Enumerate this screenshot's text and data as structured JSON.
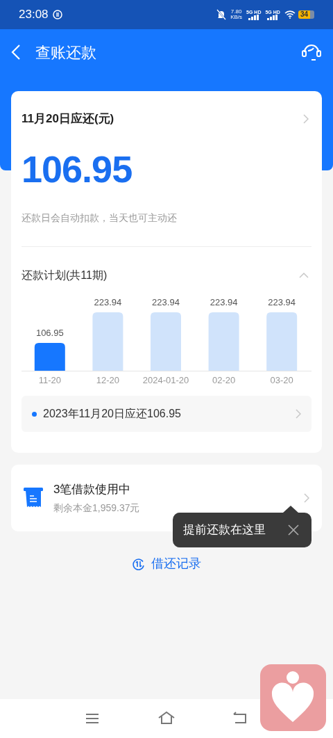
{
  "status_bar": {
    "time": "23:08",
    "speed": "7.80",
    "speed_unit": "KB/s",
    "networks": [
      "5G HD",
      "5G HD"
    ],
    "battery": "34"
  },
  "header": {
    "title": "查账还款"
  },
  "due_card": {
    "title": "11月20日应还(元)",
    "amount": "106.95",
    "note": "还款日会自动扣款，当天也可主动还"
  },
  "plan": {
    "title": "还款计划(共11期)",
    "expanded": true,
    "chart_data": {
      "type": "bar",
      "categories": [
        "11-20",
        "12-20",
        "2024-01-20",
        "02-20",
        "03-20"
      ],
      "values": [
        106.95,
        223.94,
        223.94,
        223.94,
        223.94
      ],
      "data_labels": true
    },
    "bars": [
      {
        "selected": true
      },
      {
        "selected": false
      },
      {
        "selected": false
      },
      {
        "selected": false
      },
      {
        "selected": false
      }
    ],
    "summary": "2023年11月20日应还106.95"
  },
  "loans_card": {
    "title": "3笔借款使用中",
    "subtitle": "剩余本金1,959.37元"
  },
  "tooltip": {
    "text": "提前还款在这里"
  },
  "history_link": {
    "label": "借还记录"
  }
}
